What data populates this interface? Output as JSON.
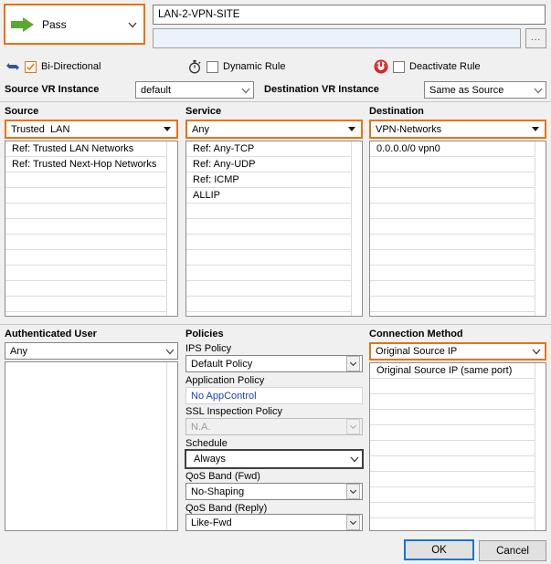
{
  "action": {
    "label": "Pass",
    "icon": "green-right-arrow-icon"
  },
  "rule": {
    "name_value": "LAN-2-VPN-SITE",
    "description_value": "",
    "browse_label": "...",
    "bidirectional": {
      "label": "Bi-Directional",
      "checked": true,
      "icon": "bidirectional-arrows-icon"
    },
    "dynamic_rule": {
      "label": "Dynamic Rule",
      "checked": false,
      "icon": "stopwatch-icon"
    },
    "deactivate_rule": {
      "label": "Deactivate Rule",
      "checked": false,
      "icon": "power-off-icon"
    }
  },
  "vr": {
    "source_label": "Source VR Instance",
    "source_value": "default",
    "destination_label": "Destination VR Instance",
    "destination_value": "Same as Source"
  },
  "source": {
    "title": "Source",
    "selected": "Trusted  LAN",
    "items": [
      "Ref: Trusted LAN Networks",
      "Ref: Trusted Next-Hop Networks"
    ]
  },
  "service": {
    "title": "Service",
    "selected": "Any",
    "items": [
      "Ref: Any-TCP",
      "Ref: Any-UDP",
      "Ref: ICMP",
      "ALLIP"
    ]
  },
  "destination": {
    "title": "Destination",
    "selected": "VPN-Networks",
    "items": [
      "0.0.0.0/0 vpn0"
    ]
  },
  "authenticated_user": {
    "title": "Authenticated User",
    "selected": "Any",
    "items": []
  },
  "policies": {
    "title": "Policies",
    "fields": [
      {
        "label": "IPS Policy",
        "value": "Default Policy",
        "style": "normal"
      },
      {
        "label": "Application Policy",
        "value": "No AppControl",
        "style": "link"
      },
      {
        "label": "SSL Inspection Policy",
        "value": "N.A.",
        "style": "disabled"
      },
      {
        "label": "Schedule",
        "value": "Always",
        "style": "focus"
      },
      {
        "label": "QoS Band (Fwd)",
        "value": "No-Shaping",
        "style": "normal"
      },
      {
        "label": "QoS Band (Reply)",
        "value": "Like-Fwd",
        "style": "normal"
      }
    ]
  },
  "connection_method": {
    "title": "Connection Method",
    "selected": "Original Source IP",
    "items": [
      "Original Source IP (same port)"
    ]
  },
  "buttons": {
    "ok": "OK",
    "cancel": "Cancel"
  },
  "colors": {
    "accent": "#e8720c",
    "focus": "#1277d4",
    "link": "#1b3fbf",
    "action": "#5aa830"
  }
}
